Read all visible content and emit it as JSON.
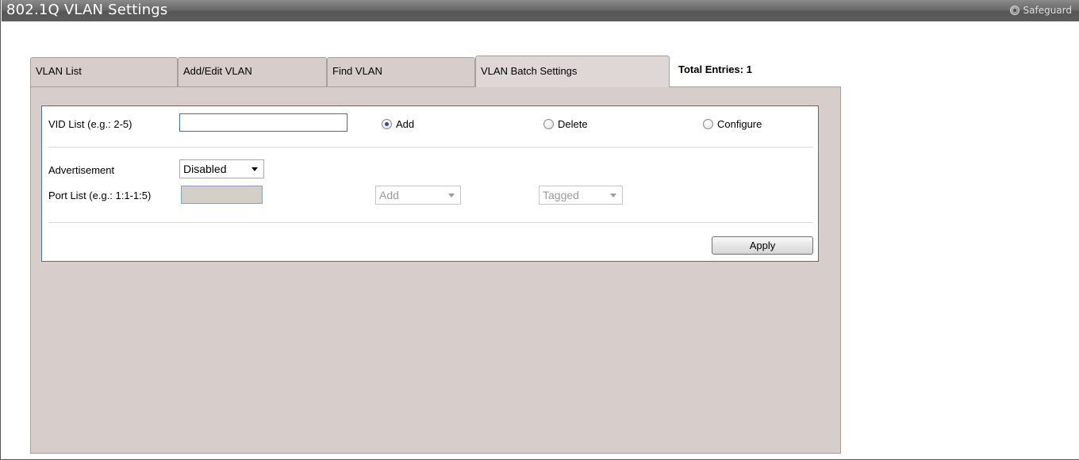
{
  "header": {
    "title": "802.1Q VLAN Settings",
    "safeguard_label": "Safeguard"
  },
  "tabs": [
    {
      "label": "VLAN List",
      "active": false
    },
    {
      "label": "Add/Edit VLAN",
      "active": false
    },
    {
      "label": "Find VLAN",
      "active": false
    },
    {
      "label": "VLAN Batch Settings",
      "active": true
    }
  ],
  "total_entries": "Total Entries: 1",
  "form": {
    "vid_list_label": "VID List (e.g.: 2-5)",
    "vid_list_value": "",
    "action_options": [
      {
        "label": "Add",
        "checked": true
      },
      {
        "label": "Delete",
        "checked": false
      },
      {
        "label": "Configure",
        "checked": false
      }
    ],
    "advertisement_label": "Advertisement",
    "advertisement_value": "Disabled",
    "port_list_label": "Port List (e.g.: 1:1-1:5)",
    "port_list_value": "",
    "port_action_value": "Add",
    "port_tag_value": "Tagged",
    "apply_label": "Apply"
  },
  "colors": {
    "title_bar": "#6a6a6a",
    "tab_background": "#d7cdcb",
    "panel_border": "#4a6d97",
    "radio_selected": "#2d4f9e"
  }
}
